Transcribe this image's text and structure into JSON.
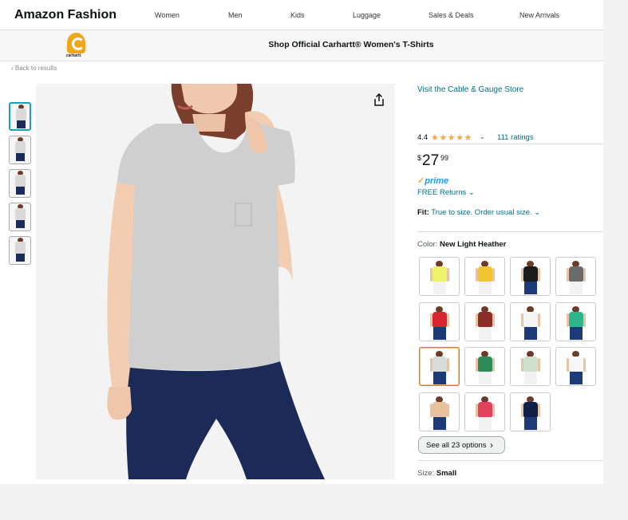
{
  "nav": {
    "brand": "Amazon Fashion",
    "links": [
      "Women",
      "Men",
      "Kids",
      "Luggage",
      "Sales & Deals",
      "New Arrivals"
    ]
  },
  "store": {
    "logo_text": "carhartt",
    "title": "Shop Official Carhartt® Women's T-Shirts"
  },
  "breadcrumb": "‹ Back to results",
  "product": {
    "visit_store": "Visit the Cable & Gauge Store",
    "rating": "4.4",
    "stars": "★★★★★",
    "rating_chevron": "⌄",
    "ratings_count": "111 ratings",
    "price": {
      "symbol": "$",
      "whole": "27",
      "fraction": "99"
    },
    "prime": "prime",
    "prime_check": "✓",
    "returns": "FREE Returns ⌄",
    "fit_label": "Fit:",
    "fit_value": "True to size. Order usual size. ⌄",
    "color_label": "Color:",
    "color_value": "New Light Heather",
    "swatches": [
      {
        "shirt": "#eef26a",
        "jean": "#f2f2f2"
      },
      {
        "shirt": "#f4c430",
        "jean": "#f2f2f2"
      },
      {
        "shirt": "#1b1b1b",
        "jean": "#1d3a78"
      },
      {
        "shirt": "#6b6b6b",
        "jean": "#f2f2f2"
      },
      {
        "shirt": "#d9252f",
        "jean": "#1d3a78"
      },
      {
        "shirt": "#8a2d24",
        "jean": "#f2f2f2"
      },
      {
        "shirt": "#f5f5f5",
        "jean": "#1d3a78"
      },
      {
        "shirt": "#2fb58a",
        "jean": "#1d3a78"
      },
      {
        "shirt": "#d8dcdc",
        "jean": "#1d3a78"
      },
      {
        "shirt": "#2e8b57",
        "jean": "#f2f2f2"
      },
      {
        "shirt": "#cfe0cf",
        "jean": "#f2f2f2"
      },
      {
        "shirt": "#f7f7f7",
        "jean": "#1d3a78"
      },
      {
        "shirt": "#e8c29a",
        "jean": "#1d3a78"
      },
      {
        "shirt": "#e0425e",
        "jean": "#f2f2f2"
      },
      {
        "shirt": "#0f1f45",
        "jean": "#1d3a78"
      }
    ],
    "see_all": "See all 23 options",
    "see_all_chevron": "›",
    "size_label": "Size:",
    "size_value": "Small"
  },
  "colors": {
    "link": "#007185",
    "star": "#f3a847",
    "selected_thumb": "#1aa3b8",
    "selected_swatch": "#e77600"
  }
}
